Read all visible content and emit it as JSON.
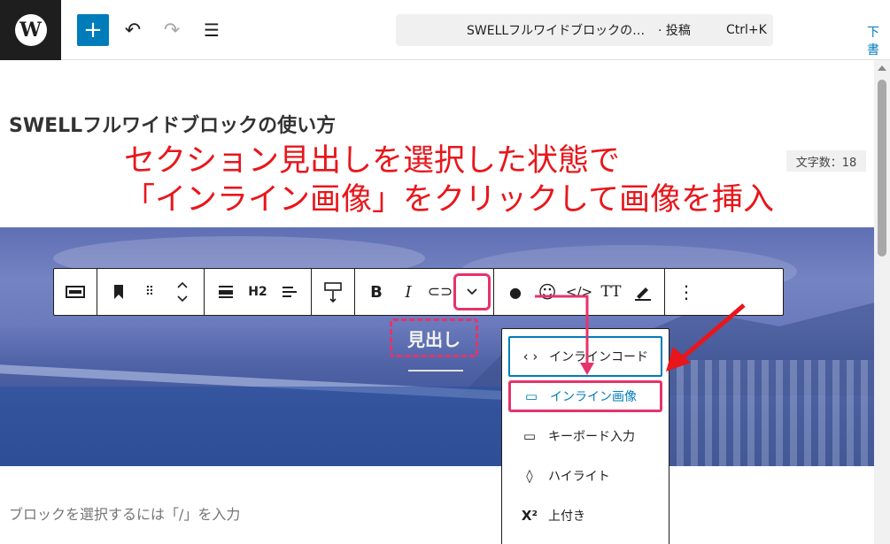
{
  "topbar": {
    "logo_letter": "W",
    "add_icon": "plus-icon",
    "undo_icon": "undo-icon",
    "redo_icon": "redo-icon",
    "list_icon": "list-view-icon",
    "command": {
      "title": "SWELLフルワイドブロックの…",
      "type": "· 投稿",
      "shortcut": "Ctrl+K"
    },
    "draft_link": "下書"
  },
  "editor": {
    "post_title": "SWELLフルワイドブロックの使い方",
    "char_count": "文字数：18",
    "heading_text": "見出し",
    "placeholder": "ブロックを選択するには「/」を入力"
  },
  "annotation": {
    "line1": "セクション見出しを選択した状態で",
    "line2": "「インライン画像」をクリックして画像を挿入",
    "color": "#e8161b"
  },
  "block_toolbar": {
    "heading_level": "H2",
    "bold": "B",
    "italic": "I",
    "typeface": "TT"
  },
  "dropdown": {
    "items": [
      {
        "icon": "code-icon",
        "glyph": "‹ ›",
        "label": "インラインコード"
      },
      {
        "icon": "inline-image-icon",
        "glyph": "▭",
        "label": "インライン画像"
      },
      {
        "icon": "keyboard-icon",
        "glyph": "▭",
        "label": "キーボード入力"
      },
      {
        "icon": "highlight-drop-icon",
        "glyph": "◊",
        "label": "ハイライト"
      },
      {
        "icon": "superscript-icon",
        "glyph": "X²",
        "label": "上付き"
      }
    ]
  },
  "colors": {
    "accent_pink": "#e5336b",
    "wp_blue": "#007cba"
  }
}
